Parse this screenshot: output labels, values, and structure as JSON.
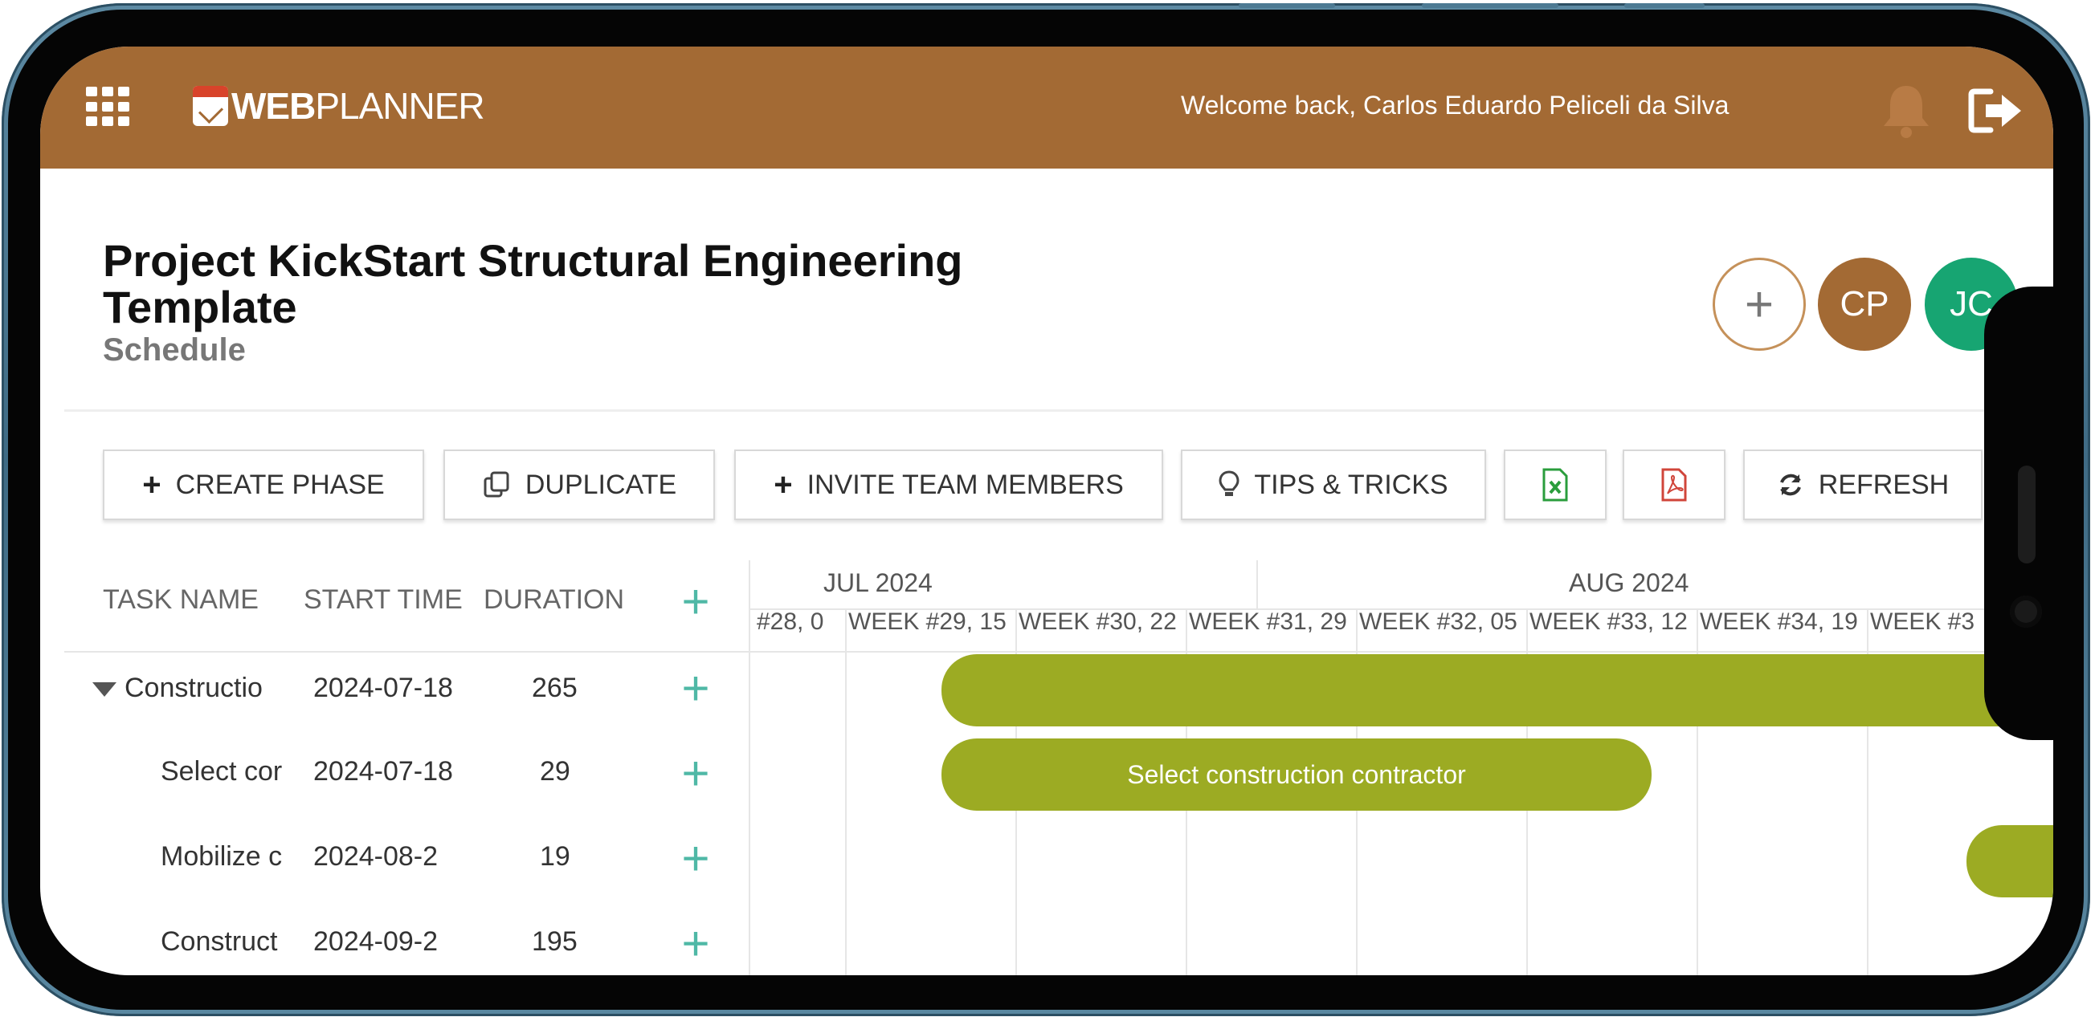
{
  "header": {
    "logo_text_bold": "WEB",
    "logo_text_rest": "PLANNER",
    "welcome": "Welcome back, Carlos Eduardo Peliceli da Silva"
  },
  "project": {
    "title": "Project KickStart Structural Engineering Template",
    "subtitle": "Schedule"
  },
  "members": {
    "add_label": "+",
    "avatars": [
      "CP",
      "JC"
    ]
  },
  "toolbar": {
    "create_phase": "CREATE PHASE",
    "duplicate": "DUPLICATE",
    "invite": "INVITE TEAM MEMBERS",
    "tips": "TIPS & TRICKS",
    "refresh": "REFRESH"
  },
  "table": {
    "columns": [
      "TASK NAME",
      "START TIME",
      "DURATION"
    ],
    "rows": [
      {
        "name": "Constructio",
        "start": "2024-07-18",
        "duration": "265"
      },
      {
        "name": "Select cor",
        "start": "2024-07-18",
        "duration": "29"
      },
      {
        "name": "Mobilize c",
        "start": "2024-08-2",
        "duration": "19"
      },
      {
        "name": "Construct",
        "start": "2024-09-2",
        "duration": "195"
      }
    ]
  },
  "timeline": {
    "months": [
      "JUL 2024",
      "AUG 2024"
    ],
    "weeks": [
      "#28, 0",
      "WEEK #29, 15",
      "WEEK #30, 22",
      "WEEK #31, 29",
      "WEEK #32, 05",
      "WEEK #33, 12",
      "WEEK #34, 19",
      "WEEK #3"
    ],
    "bars": [
      {
        "label": ""
      },
      {
        "label": "Select construction contractor"
      },
      {
        "label": ""
      }
    ]
  },
  "colors": {
    "header": "#a36a34",
    "bar": "#9cab23",
    "accent": "#4fb8a6",
    "avatar_jc": "#17a572"
  },
  "icons": [
    "apps-grid-icon",
    "bell-icon",
    "logout-icon",
    "plus-icon",
    "duplicate-icon",
    "lightbulb-icon",
    "excel-icon",
    "pdf-icon",
    "refresh-icon",
    "collapse-caret-icon"
  ]
}
